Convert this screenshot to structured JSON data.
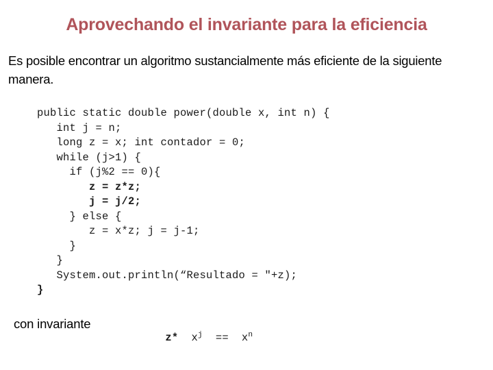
{
  "slide": {
    "title": "Aprovechando el invariante para la eficiencia",
    "title_color": "#b0545a",
    "body_text": "Es posible encontrar un algoritmo sustancialmente más eficiente de la siguiente manera.",
    "code": {
      "language": "java",
      "lines": [
        {
          "text": "public static double power(double x, int n) {",
          "bold": false
        },
        {
          "text": "   int j = n;",
          "bold": false
        },
        {
          "text": "   long z = x; int contador = 0;",
          "bold": false
        },
        {
          "text": "   while (j>1) {",
          "bold": false
        },
        {
          "text": "     if (j%2 == 0){",
          "bold": false
        },
        {
          "text": "        z = z*z;",
          "bold": true
        },
        {
          "text": "        j = j/2;",
          "bold": true
        },
        {
          "text": "     } else {",
          "bold": false
        },
        {
          "text": "        z = x*z; j = j-1;",
          "bold": false
        },
        {
          "text": "     }",
          "bold": false
        },
        {
          "text": "   }",
          "bold": false
        },
        {
          "text": "   System.out.println(“Resultado = \"+z);",
          "bold": false
        },
        {
          "text": "}",
          "bold": true
        }
      ]
    },
    "footer": {
      "label": "con invariante",
      "invariant": {
        "term_bold": "z*",
        "base_1": "x",
        "exponent_1": "j",
        "operator": "==",
        "base_2": "x",
        "exponent_2": "n"
      }
    }
  }
}
